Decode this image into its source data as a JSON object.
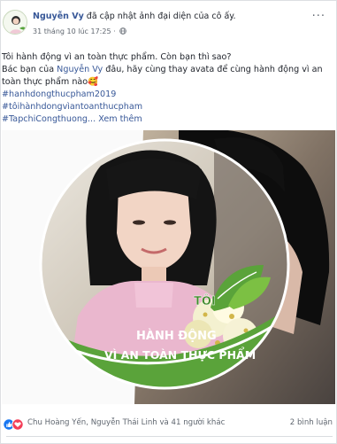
{
  "post": {
    "author": "Nguyễn Vy",
    "action": " đã cập nhật ảnh đại diện của cô ấy.",
    "timestamp": "31 tháng 10 lúc 17:25",
    "privacy_icon": "globe-icon",
    "more_icon": "ellipsis-icon",
    "line1": "Tôi hành động vì an toàn thực phẩm. Còn bạn thì sao?",
    "line2_prefix": "Bác bạn của ",
    "line2_link": "Nguyễn Vy",
    "line2_suffix": " đâu, hãy cùng thay avata để cùng hành động vì an",
    "line3": "toàn thực phẩm nào",
    "line3_emoji": "🥰",
    "hashtag1": "#hanhdongthucpham2019",
    "hashtag2": "#tôihànhdongvìantoanthucpham",
    "hashtag3": "#TapchiCongthuong",
    "see_more": "... Xem thêm"
  },
  "frame": {
    "line1": "TÔI",
    "line2": "HÀNH ĐỘNG",
    "line3": "VÌ AN TOÀN THỰC PHẨM",
    "green": "#5aa33a",
    "dark_green": "#3f8a2a"
  },
  "reactions": {
    "icons": [
      "like-icon",
      "love-icon"
    ],
    "text": "Chu Hoàng Yến, Nguyễn Thái Linh và 41 người khác",
    "comments": "2 bình luận",
    "like_color": "#1877f2",
    "love_color": "#f33e58"
  }
}
